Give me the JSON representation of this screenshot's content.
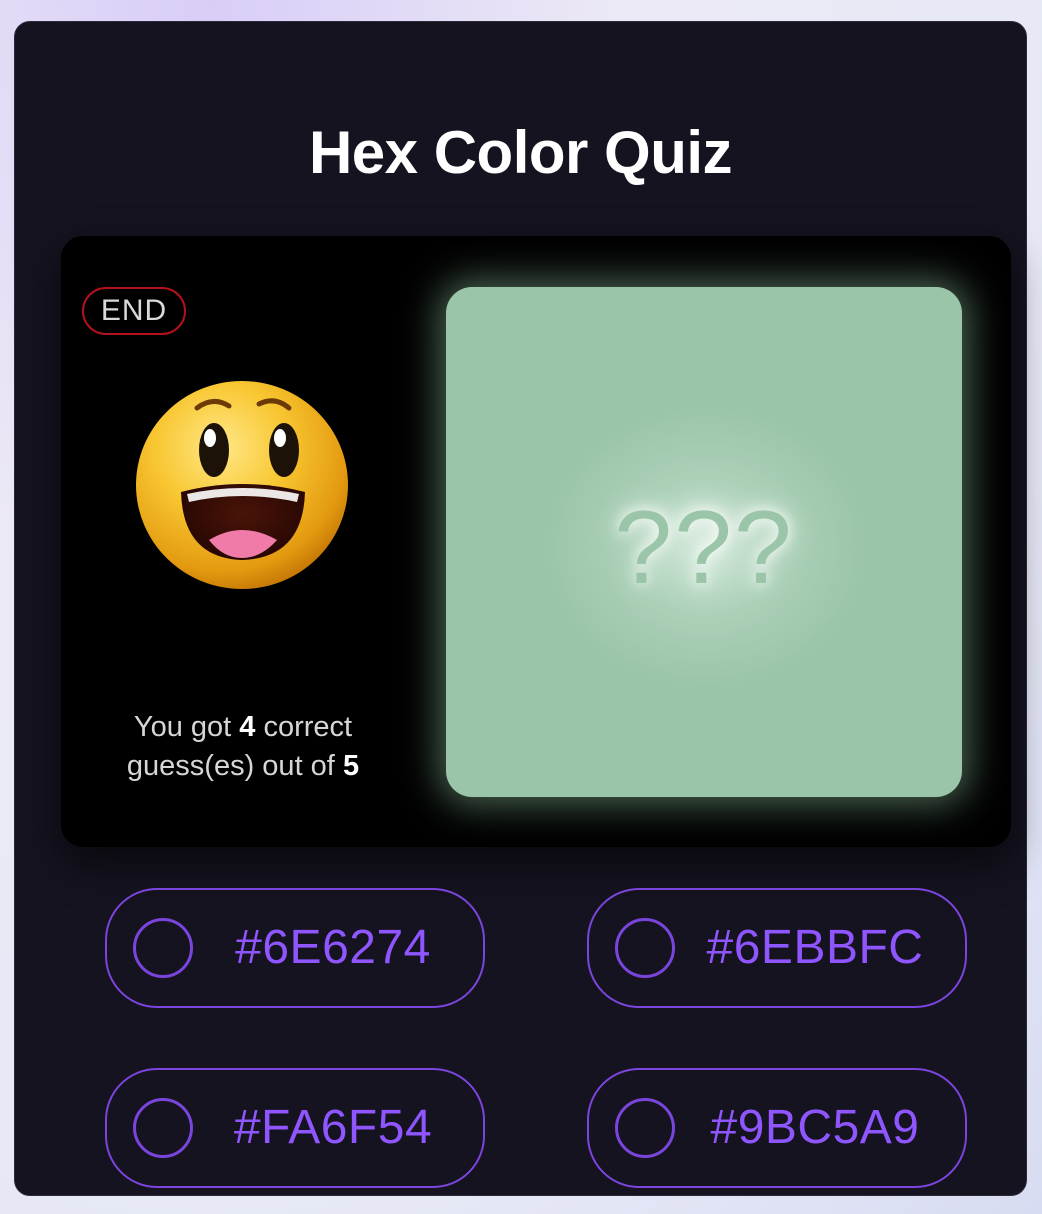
{
  "quiz": {
    "title": "Hex Color Quiz",
    "status_badge": "END",
    "score": {
      "prefix": "You got",
      "correct": "4",
      "middle": "correct guess(es) out of",
      "total": "5"
    },
    "swatch": {
      "color": "#9BC5A9",
      "mystery_label": "???"
    },
    "emoji_icon": "grinning-face-emoji",
    "options": [
      {
        "label": "#6E6274"
      },
      {
        "label": "#6EBBFC"
      },
      {
        "label": "#FA6F54"
      },
      {
        "label": "#9BC5A9"
      }
    ]
  },
  "colors": {
    "accent": "#8F55FF",
    "badge_border": "#B3121C",
    "card_bg": "#14131F"
  }
}
